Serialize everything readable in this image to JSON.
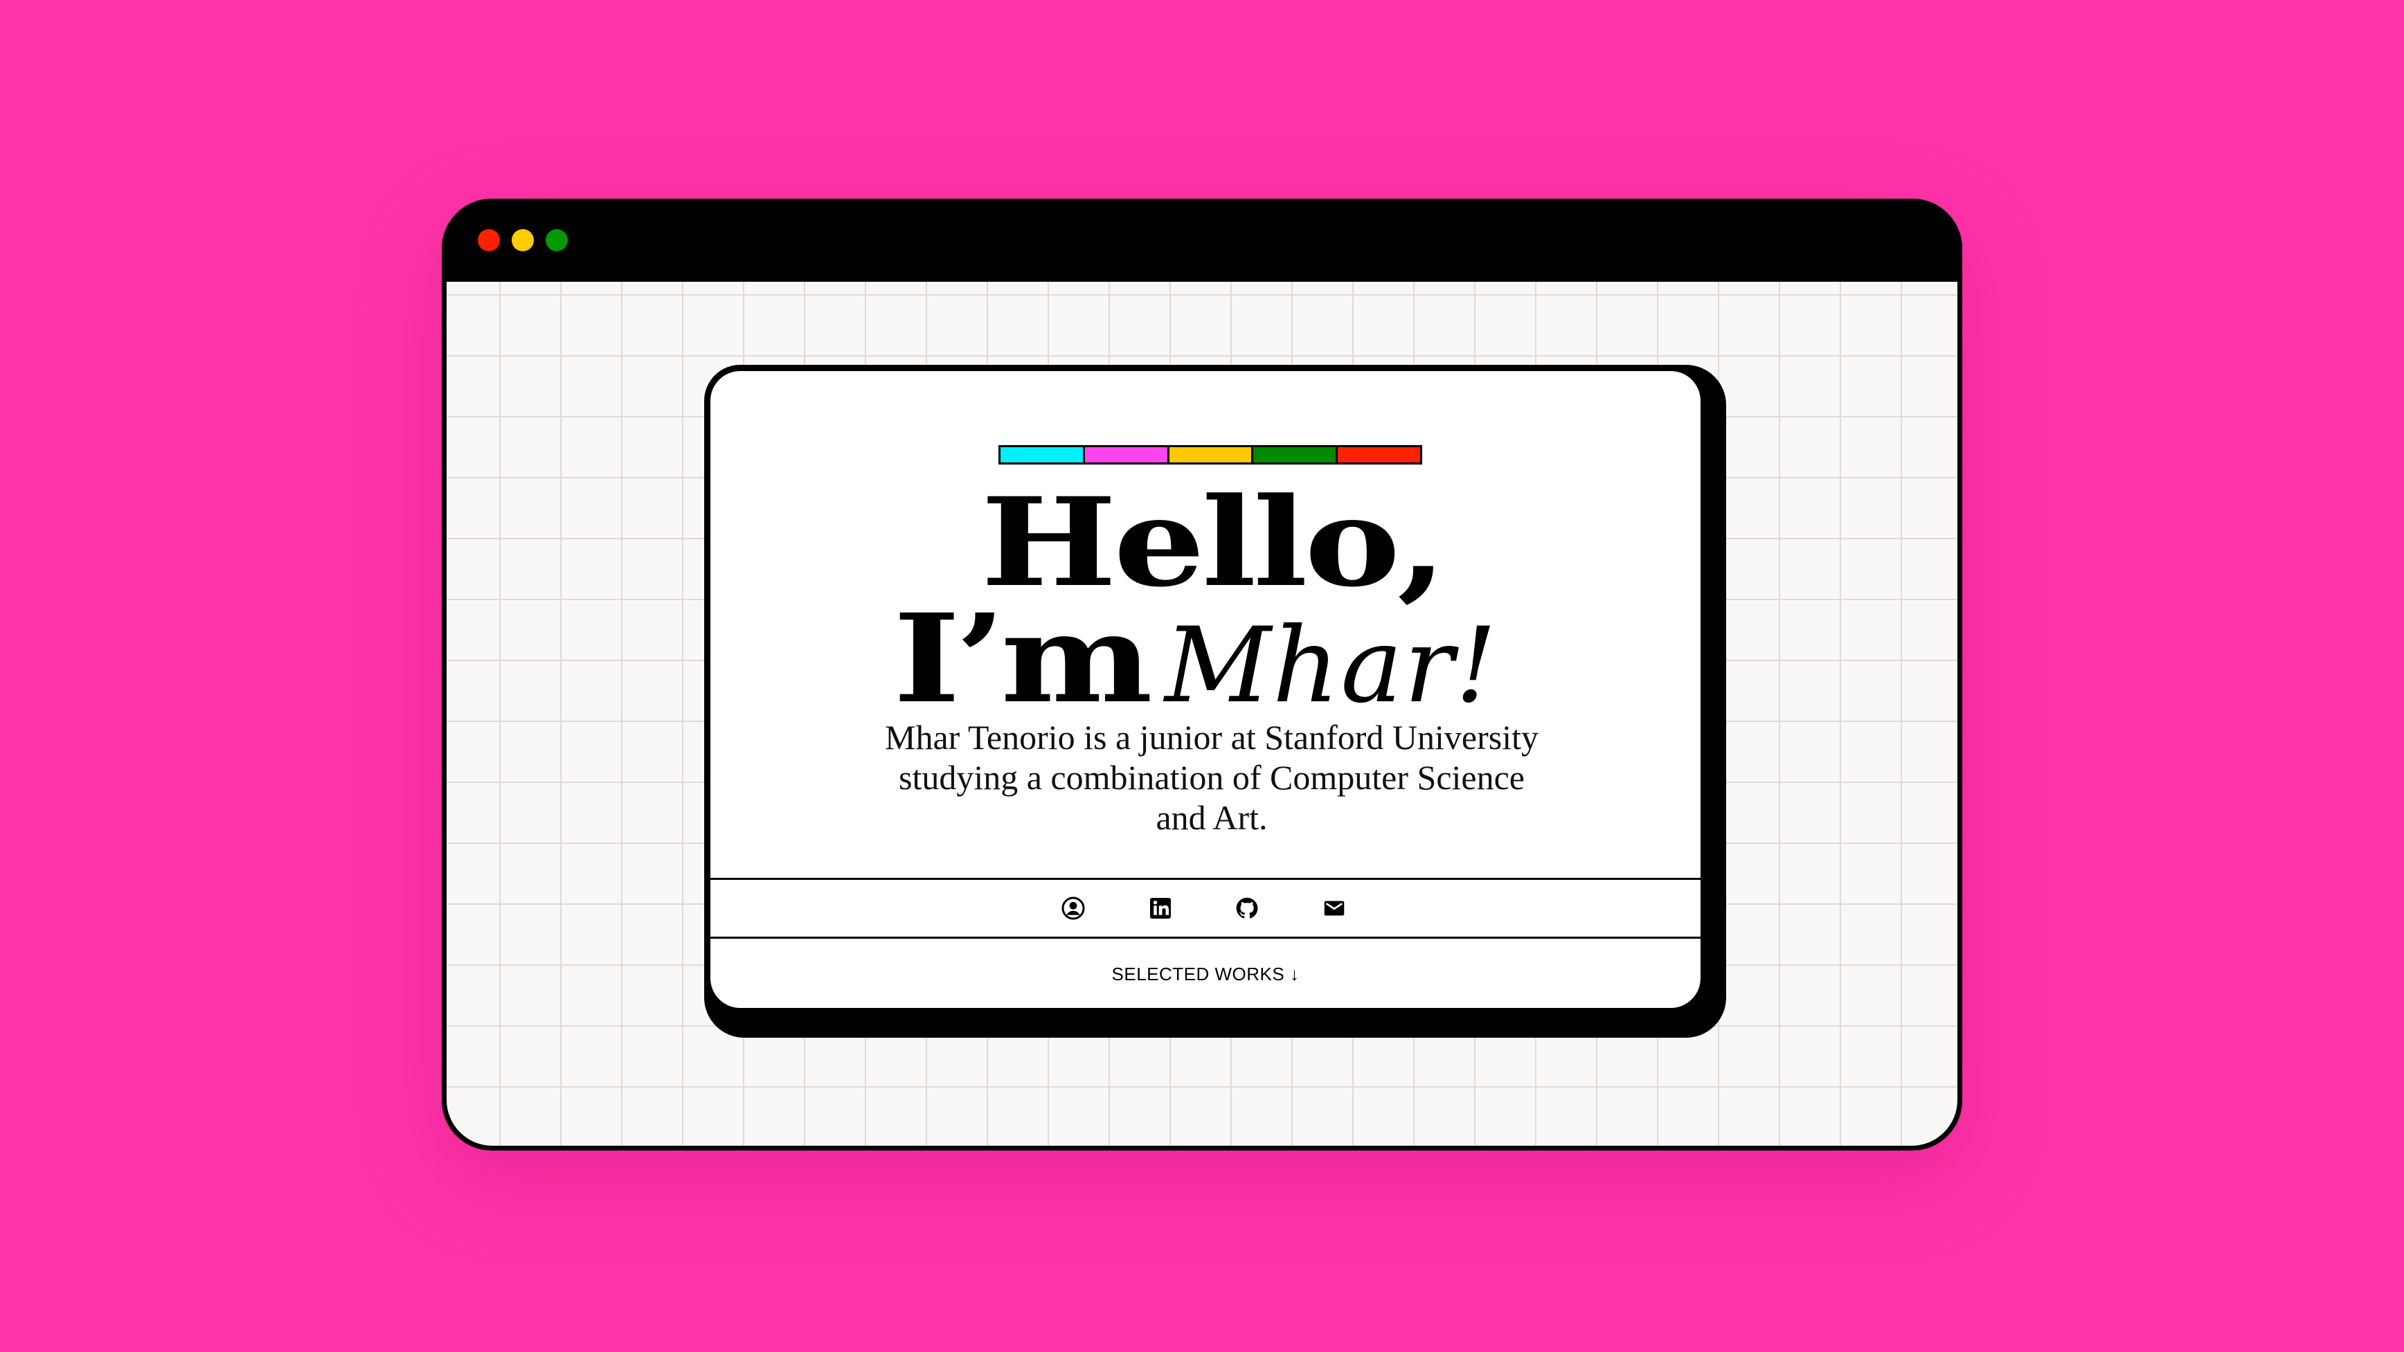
{
  "colors": {
    "background": "#ff33a8",
    "window_dots": [
      "#ff2200",
      "#ffcc00",
      "#009900"
    ],
    "stripe": [
      "#00f0ff",
      "#ff44ee",
      "#ffc800",
      "#008a00",
      "#ff2200"
    ]
  },
  "hero": {
    "line1": "Hello,",
    "line2": "I’m",
    "name": "Mhar!",
    "bio": "Mhar Tenorio is a junior at Stanford University studying a combination of Computer Science and Art."
  },
  "social": [
    {
      "icon": "user-circle-icon"
    },
    {
      "icon": "linkedin-icon"
    },
    {
      "icon": "github-icon"
    },
    {
      "icon": "mail-icon"
    }
  ],
  "cta": {
    "label": "SELECTED WORKS ↓"
  }
}
